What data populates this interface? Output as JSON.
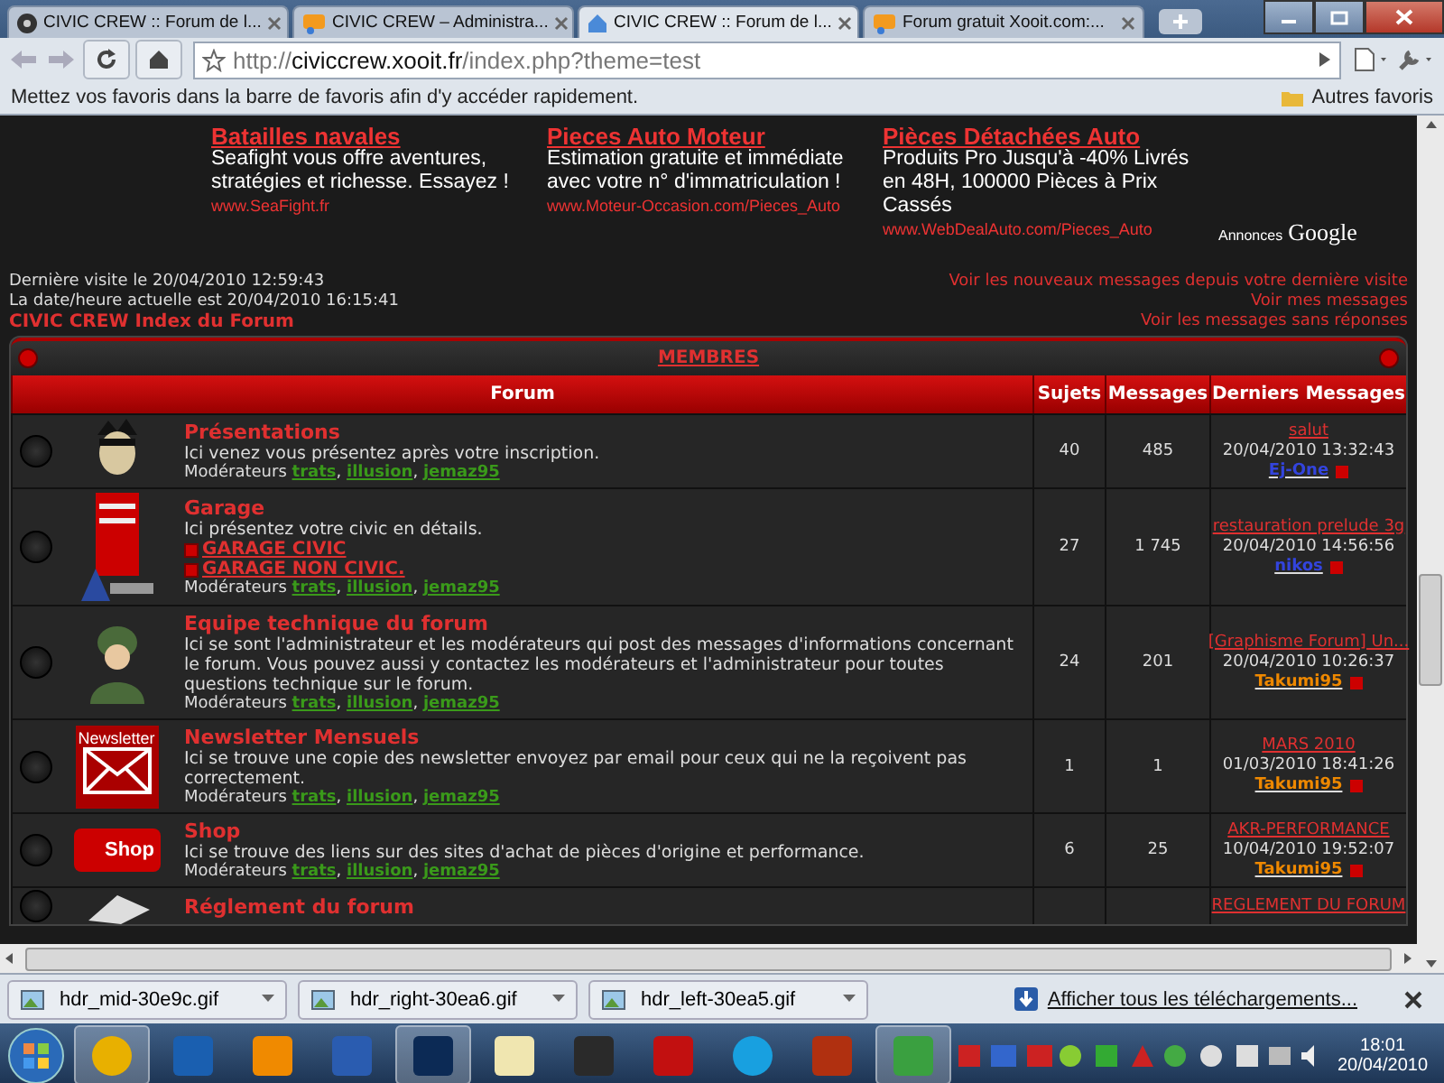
{
  "browser": {
    "tabs": [
      {
        "title": "CIVIC CREW :: Forum de l...",
        "kind": "wheel",
        "selected": false
      },
      {
        "title": "CIVIC CREW – Administra...",
        "kind": "xooit",
        "selected": false
      },
      {
        "title": "CIVIC CREW :: Forum de l...",
        "kind": "house",
        "selected": true
      },
      {
        "title": "Forum gratuit Xooit.com:...",
        "kind": "xooit",
        "selected": false
      }
    ],
    "url": {
      "scheme": "http://",
      "host": "civiccrew.xooit.fr",
      "path": "/index.php?theme=test"
    },
    "bookmarks_hint": "Mettez vos favoris dans la barre de favoris afin d'y accéder rapidement.",
    "other_bookmarks": "Autres favoris"
  },
  "ads": [
    {
      "title": "Batailles navales",
      "text": "Seafight vous offre aventures, stratégies et richesse. Essayez !",
      "url": "www.SeaFight.fr"
    },
    {
      "title": "Pieces Auto Moteur",
      "text": "Estimation gratuite et immédiate avec votre n° d'immatriculation !",
      "url": "www.Moteur-Occasion.com/Pieces_Auto"
    },
    {
      "title": "Pièces Détachées Auto",
      "text": "Produits Pro Jusqu'à -40% Livrés en 48H, 100000 Pièces à Prix Cassés",
      "url": "www.WebDealAuto.com/Pieces_Auto"
    }
  ],
  "ads_label": "Annonces",
  "ads_brand": "Google",
  "info": {
    "last_visit": "Dernière visite le 20/04/2010 12:59:43",
    "current": "La date/heure actuelle est 20/04/2010 16:15:41",
    "breadcrumb": "CIVIC CREW Index du Forum",
    "links": [
      "Voir les nouveaux messages depuis votre dernière visite",
      "Voir mes messages",
      "Voir les messages sans réponses"
    ]
  },
  "category": "MEMBRES",
  "columns": [
    "Forum",
    "Sujets",
    "Messages",
    "Derniers Messages"
  ],
  "moderator_separator": ", ",
  "forums": [
    {
      "kind": "cartoon",
      "title": "Présentations",
      "description": "Ici venez vous présentez après votre inscription.",
      "moderators_label": "Modérateurs",
      "moderators": [
        "trats",
        "illusion",
        "jemaz95"
      ],
      "topics": "40",
      "posts": "485",
      "last": {
        "title": "salut",
        "date": "20/04/2010 13:32:43",
        "user": "Ej-One",
        "color": "#3344dd"
      }
    },
    {
      "kind": "toolbox",
      "title": "Garage",
      "description": "Ici présentez votre civic en détails.",
      "subforums": [
        "GARAGE CIVIC",
        "GARAGE NON CIVIC."
      ],
      "moderators_label": "Modérateurs",
      "moderators": [
        "trats",
        "illusion",
        "jemaz95"
      ],
      "topics": "27",
      "posts": "1 745",
      "last": {
        "title": "restauration prelude 3g",
        "date": "20/04/2010 14:56:56",
        "user": "nikos",
        "color": "#3344dd"
      }
    },
    {
      "kind": "soldier",
      "title": "Equipe technique du forum",
      "description": "Ici se sont l'administrateur et les modérateurs qui post des messages d'informations concernant le forum. Vous pouvez aussi y contactez les modérateurs et l'administrateur pour toutes questions technique sur le forum.",
      "moderators_label": "Modérateurs",
      "moderators": [
        "trats",
        "illusion",
        "jemaz95"
      ],
      "topics": "24",
      "posts": "201",
      "last": {
        "title": "[Graphisme Forum] Un...",
        "date": "20/04/2010 10:26:37",
        "user": "Takumi95",
        "color": "#ee8800"
      }
    },
    {
      "kind": "newsletter",
      "icon_text": "Newsletter",
      "title": "Newsletter Mensuels",
      "description": "Ici se trouve une copie des newsletter envoyez par email pour ceux qui ne la reçoivent pas correctement.",
      "moderators_label": "Modérateurs",
      "moderators": [
        "trats",
        "illusion",
        "jemaz95"
      ],
      "topics": "1",
      "posts": "1",
      "last": {
        "title": "MARS 2010",
        "date": "01/03/2010 18:41:26",
        "user": "Takumi95",
        "color": "#ee8800"
      }
    },
    {
      "kind": "shop",
      "icon_text": "Shop",
      "title": "Shop",
      "description": "Ici se trouve des liens sur des sites d'achat de pièces d'origine et performance.",
      "moderators_label": "Modérateurs",
      "moderators": [
        "trats",
        "illusion",
        "jemaz95"
      ],
      "topics": "6",
      "posts": "25",
      "last": {
        "title": "AKR-PERFORMANCE",
        "date": "10/04/2010 19:52:07",
        "user": "Takumi95",
        "color": "#ee8800"
      }
    },
    {
      "kind": "document",
      "title": "Réglement du forum",
      "last": {
        "title": "REGLEMENT DU FORUM"
      }
    }
  ],
  "downloads": [
    {
      "name": "hdr_mid-30e9c.gif"
    },
    {
      "name": "hdr_right-30ea6.gif"
    },
    {
      "name": "hdr_left-30ea5.gif"
    }
  ],
  "show_all_downloads": "Afficher tous les téléchargements...",
  "taskbar": {
    "apps": [
      {
        "kind": "chrome",
        "selected": true
      },
      {
        "kind": "db",
        "selected": false
      },
      {
        "kind": "player",
        "selected": false
      },
      {
        "kind": "word",
        "selected": false
      },
      {
        "kind": "photoshop",
        "selected": true
      },
      {
        "kind": "notepad",
        "selected": false
      },
      {
        "kind": "tool",
        "selected": false
      },
      {
        "kind": "filezilla",
        "selected": false
      },
      {
        "kind": "skype",
        "selected": false
      },
      {
        "kind": "game",
        "selected": false
      },
      {
        "kind": "messenger",
        "selected": true
      }
    ],
    "time": "18:01",
    "date": "20/04/2010"
  }
}
